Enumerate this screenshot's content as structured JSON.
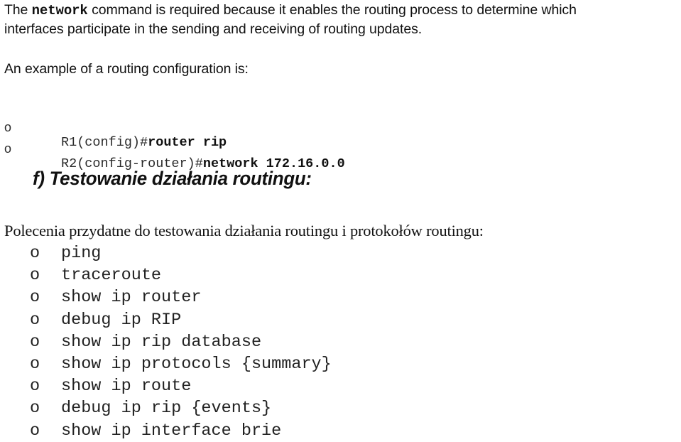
{
  "intro": {
    "line1_prefix": "The ",
    "line1_code": "network",
    "line1_suffix": " command is required because it enables the routing process to determine which",
    "line2": "interfaces participate in the sending and receiving of routing updates."
  },
  "example": {
    "intro": "An example of a routing configuration is:",
    "items": [
      {
        "bullet": "o",
        "prompt": "R1(config)#",
        "command": "router rip"
      },
      {
        "bullet": "o",
        "prompt": "R2(config-router)#",
        "command": "network 172.16.0.0"
      }
    ]
  },
  "section": {
    "heading": "f) Testowanie działania routingu:"
  },
  "commands": {
    "intro": "Polecenia przydatne do testowania działania routingu i protokołów routingu:",
    "items": [
      {
        "bullet": "o",
        "text": "ping"
      },
      {
        "bullet": "o",
        "text": "traceroute"
      },
      {
        "bullet": "o",
        "text": "show ip router"
      },
      {
        "bullet": "o",
        "text": "debug ip RIP"
      },
      {
        "bullet": "o",
        "text": "show ip rip database"
      },
      {
        "bullet": "o",
        "text": "show ip protocols {summary}"
      },
      {
        "bullet": "o",
        "text": "show ip route"
      },
      {
        "bullet": "o",
        "text": "debug ip rip {events}"
      },
      {
        "bullet": "o",
        "text": "show ip interface brie"
      }
    ]
  }
}
